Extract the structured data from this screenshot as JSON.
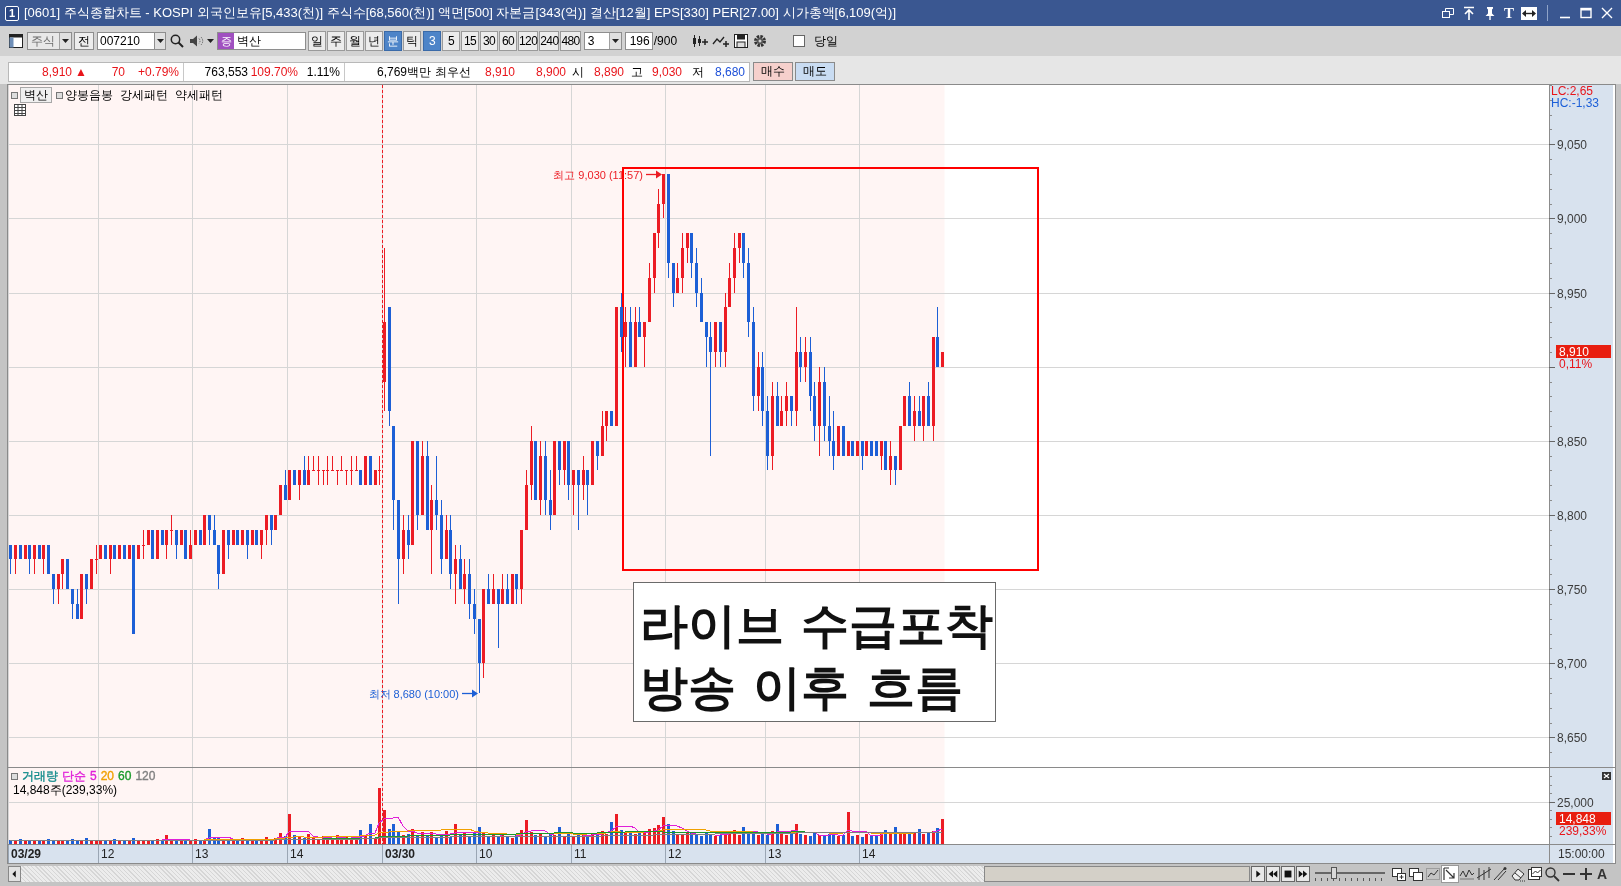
{
  "window": {
    "badge": "1",
    "title": "[0601] 주식종합차트 - KOSPI 외국인보유[5,433(천)] 주식수[68,560(천)] 액면[500] 자본금[343(억)] 결산[12월] EPS[330] PER[27.00] 시가총액[6,109(억)]",
    "text_tool": "T",
    "fit_width_on": true
  },
  "toolbar": {
    "market": {
      "value": "주식",
      "disabled": true
    },
    "prev_button": "전",
    "code": "007210",
    "exchange_badge": "증",
    "stock_name": "벽산",
    "periods": [
      {
        "label": "일",
        "selected": false
      },
      {
        "label": "주",
        "selected": false
      },
      {
        "label": "월",
        "selected": false
      },
      {
        "label": "년",
        "selected": false
      },
      {
        "label": "분",
        "selected": true
      },
      {
        "label": "틱",
        "selected": false
      }
    ],
    "intervals": [
      {
        "label": "3",
        "selected": true
      },
      {
        "label": "5",
        "selected": false
      },
      {
        "label": "15",
        "selected": false
      },
      {
        "label": "30",
        "selected": false
      },
      {
        "label": "60",
        "selected": false
      },
      {
        "label": "120",
        "selected": false
      },
      {
        "label": "240",
        "selected": false
      },
      {
        "label": "480",
        "selected": false
      }
    ],
    "interval_select": "3",
    "count": "196",
    "count_max": "/900",
    "today": {
      "label": "당일",
      "checked": false
    }
  },
  "quote_bar": {
    "cells": [
      {
        "items": [
          {
            "text": "8,910",
            "color": "#e8141a"
          },
          {
            "text": "▲",
            "color": "#e8141a"
          },
          {
            "text": "70",
            "color": "#e8141a"
          },
          {
            "text": "+0.79%",
            "color": "#e8141a"
          }
        ]
      },
      {
        "items": [
          {
            "text": "763,553"
          },
          {
            "text": "109.70%",
            "color": "#e8141a"
          },
          {
            "text": "1.11%"
          }
        ]
      },
      {
        "items": [
          {
            "text": "6,769백만"
          },
          {
            "text": "최우선"
          },
          {
            "text": "8,910",
            "color": "#e8141a"
          },
          {
            "text": "8,900",
            "color": "#e8141a"
          },
          {
            "text": "시"
          },
          {
            "text": "8,890",
            "color": "#e8141a"
          },
          {
            "text": "고"
          },
          {
            "text": "9,030",
            "color": "#e8141a"
          },
          {
            "text": "저"
          },
          {
            "text": "8,680",
            "color": "#1c4fd8"
          }
        ]
      }
    ],
    "buy_button": "매수",
    "sell_button": "매도"
  },
  "price_panel": {
    "series_name": "벽산",
    "legend": [
      {
        "label": "양봉음봉",
        "kind": "indicator"
      },
      {
        "label": "강세패턴",
        "kind": "pattern"
      },
      {
        "label": "약세패턴",
        "kind": "pattern"
      }
    ],
    "axis_labels": [
      "9,050",
      "9,000",
      "8,950",
      "8,850",
      "8,800",
      "8,750",
      "8,700",
      "8,650"
    ],
    "lc": "LC:2,65",
    "hc": "HC:-1,33",
    "last_price_tag": "8,910",
    "last_change_tag": "0,11%",
    "high_note": "최고 9,030 (11:57)",
    "low_note": "최저 8,680 (10:00)",
    "caption": [
      "라이브 수급포착",
      "방송 이후 흐름"
    ]
  },
  "volume_panel": {
    "legend": [
      {
        "label": "거래량",
        "color": "#148c8c",
        "kind": "series"
      },
      {
        "label": "단순",
        "color": "#e020d8",
        "kind": "method"
      },
      {
        "label": "5",
        "color": "#e020d8",
        "kind": "average"
      },
      {
        "label": "20",
        "color": "#f0a000",
        "kind": "average"
      },
      {
        "label": "60",
        "color": "#1a9a2a",
        "kind": "average"
      },
      {
        "label": "120",
        "color": "#808080",
        "kind": "average"
      }
    ],
    "reading": "14,848주(239,33%)",
    "axis_label": "25,000",
    "last_volume_tag": "14,848",
    "last_ratio_tag": "239,33%"
  },
  "time_axis": {
    "labels": [
      "03/29",
      "12",
      "13",
      "14",
      "03/30",
      "10",
      "11",
      "12",
      "13",
      "14"
    ],
    "cursor_time": "15:00:00"
  },
  "bottom_bar": {
    "zoom_slider": {
      "level": 0.27
    },
    "cursor_tool_selected": true,
    "font_button": "A"
  }
}
